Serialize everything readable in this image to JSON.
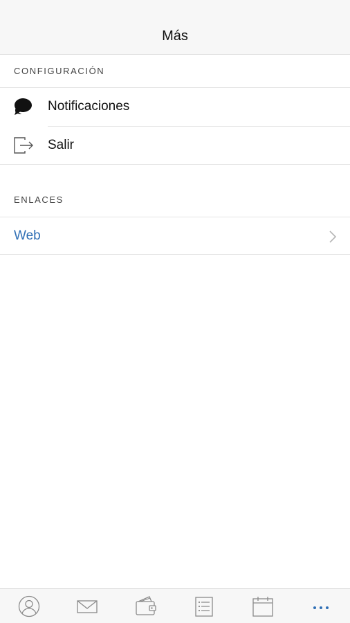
{
  "header": {
    "title": "Más"
  },
  "sections": {
    "settings": {
      "title": "CONFIGURACIÓN",
      "items": [
        {
          "label": "Notificaciones",
          "icon": "chat-bubbles-icon"
        },
        {
          "label": "Salir",
          "icon": "logout-icon"
        }
      ]
    },
    "links": {
      "title": "ENLACES",
      "items": [
        {
          "label": "Web",
          "icon": "chevron-right-icon"
        }
      ]
    }
  },
  "tabbar": {
    "items": [
      {
        "icon": "profile-icon",
        "active": false
      },
      {
        "icon": "mail-icon",
        "active": false
      },
      {
        "icon": "wallet-icon",
        "active": false
      },
      {
        "icon": "list-icon",
        "active": false
      },
      {
        "icon": "calendar-icon",
        "active": false
      },
      {
        "icon": "more-dots-icon",
        "active": true
      }
    ]
  },
  "colors": {
    "accent": "#2f6fb5",
    "icon_gray": "#8a8a8a",
    "header_bg": "#f7f7f7"
  }
}
